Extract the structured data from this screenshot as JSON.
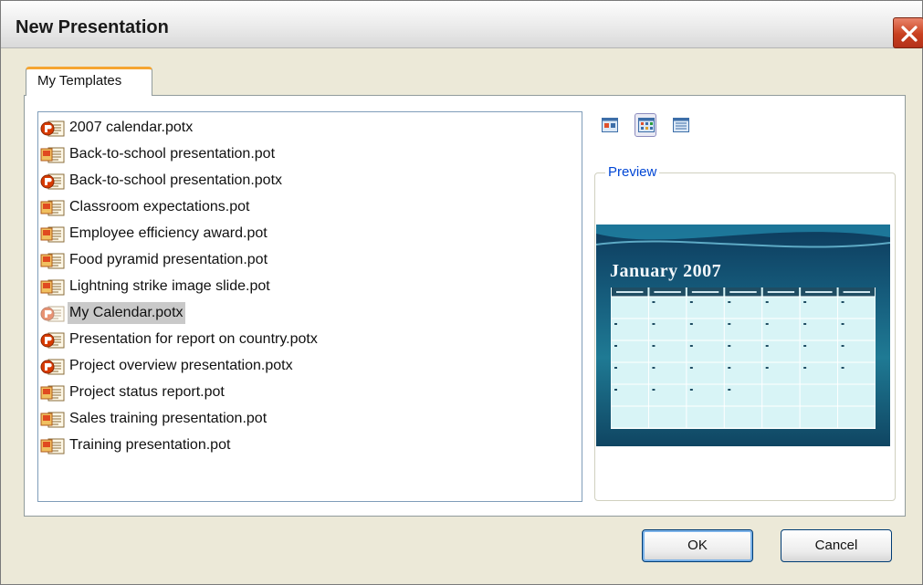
{
  "dialog": {
    "title": "New Presentation"
  },
  "tabs": [
    {
      "label": "My Templates",
      "active": true
    }
  ],
  "templates": [
    {
      "name": "2007 calendar.potx",
      "icon": "potx-icon"
    },
    {
      "name": "Back-to-school presentation.pot",
      "icon": "pot-icon"
    },
    {
      "name": "Back-to-school presentation.potx",
      "icon": "potx-icon"
    },
    {
      "name": "Classroom expectations.pot",
      "icon": "pot-icon"
    },
    {
      "name": "Employee efficiency award.pot",
      "icon": "pot-icon"
    },
    {
      "name": "Food pyramid presentation.pot",
      "icon": "pot-icon"
    },
    {
      "name": "Lightning strike image slide.pot",
      "icon": "pot-icon"
    },
    {
      "name": "My Calendar.potx",
      "icon": "potx-icon",
      "selected": true
    },
    {
      "name": "Presentation for report on country.potx",
      "icon": "potx-icon"
    },
    {
      "name": "Project overview presentation.potx",
      "icon": "potx-icon"
    },
    {
      "name": "Project status report.pot",
      "icon": "pot-icon"
    },
    {
      "name": "Sales training presentation.pot",
      "icon": "pot-icon"
    },
    {
      "name": "Training presentation.pot",
      "icon": "pot-icon"
    }
  ],
  "view_buttons": [
    {
      "name": "large-icons-view-icon",
      "active": false
    },
    {
      "name": "list-view-icon",
      "active": true
    },
    {
      "name": "details-view-icon",
      "active": false
    }
  ],
  "preview": {
    "legend": "Preview",
    "month_title": "January 2007"
  },
  "buttons": {
    "ok": "OK",
    "cancel": "Cancel"
  },
  "colors": {
    "tab_accent": "#f5a531",
    "close_button": "#c8401f",
    "preview_legend": "#0046d5",
    "selection": "#c9c9c9"
  }
}
